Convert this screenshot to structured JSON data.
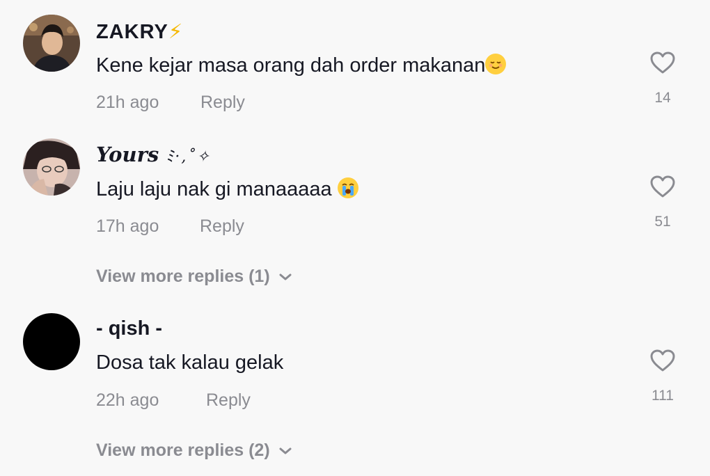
{
  "comments": [
    {
      "username": "ZAKRY",
      "username_suffix": "⚡",
      "text": "Kene kejar masa orang dah order makanan",
      "emoji": "relieved-face",
      "time": "21h ago",
      "reply_label": "Reply",
      "likes": "14",
      "avatar": "photo"
    },
    {
      "username": "Yours",
      "username_suffix": "ﾐ·,˚✧",
      "text": "Laju laju nak gi manaaaaa",
      "emoji": "crying-face",
      "time": "17h ago",
      "reply_label": "Reply",
      "likes": "51",
      "avatar": "photo",
      "view_more": "View more replies (1)"
    },
    {
      "username": "- qish -",
      "text": "Dosa tak kalau gelak",
      "time": "22h ago",
      "reply_label": "Reply",
      "likes": "111",
      "avatar": "black",
      "view_more": "View more replies (2)"
    }
  ],
  "colors": {
    "background": "#f8f8f8",
    "text": "#161823",
    "secondary": "#8a8b91"
  }
}
